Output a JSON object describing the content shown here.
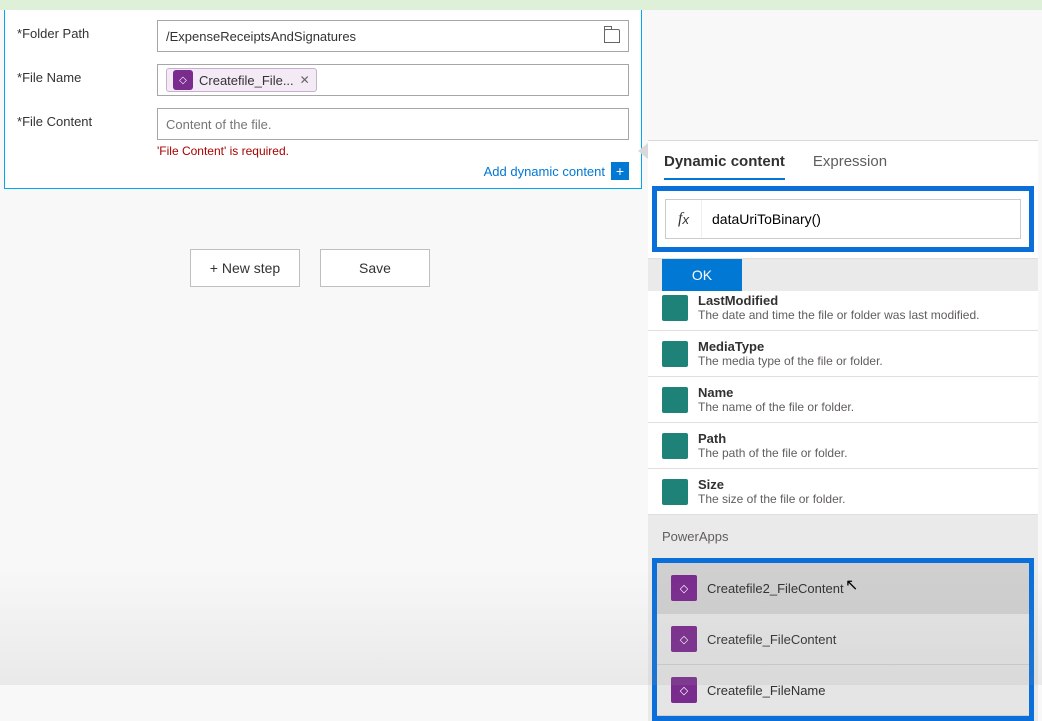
{
  "form": {
    "folder_label": "Folder Path",
    "folder_value": "/ExpenseReceiptsAndSignatures",
    "filename_label": "File Name",
    "filename_token": "Createfile_File...",
    "filecontent_label": "File Content",
    "filecontent_placeholder": "Content of the file.",
    "filecontent_error": "'File Content' is required.",
    "add_dynamic": "Add dynamic content"
  },
  "actions": {
    "new_step": "+ New step",
    "save": "Save"
  },
  "flyout": {
    "tab_dynamic": "Dynamic content",
    "tab_expression": "Expression",
    "fx_value": "dataUriToBinary()",
    "ok": "OK",
    "items": [
      {
        "title": "LastModified",
        "desc": "The date and time the file or folder was last modified."
      },
      {
        "title": "MediaType",
        "desc": "The media type of the file or folder."
      },
      {
        "title": "Name",
        "desc": "The name of the file or folder."
      },
      {
        "title": "Path",
        "desc": "The path of the file or folder."
      },
      {
        "title": "Size",
        "desc": "The size of the file or folder."
      }
    ],
    "section_powerapps": "PowerApps",
    "pa_items": [
      "Createfile2_FileContent",
      "Createfile_FileContent",
      "Createfile_FileName"
    ]
  }
}
